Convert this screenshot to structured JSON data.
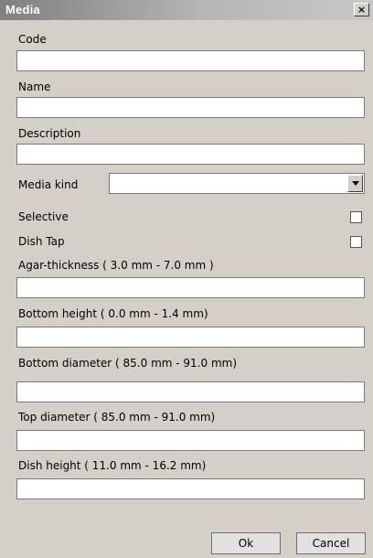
{
  "window": {
    "title": "Media",
    "close_label": "×"
  },
  "fields": {
    "code": {
      "label": "Code",
      "value": ""
    },
    "name": {
      "label": "Name",
      "value": ""
    },
    "description": {
      "label": "Description",
      "value": ""
    },
    "media_kind": {
      "label": "Media kind",
      "value": ""
    },
    "selective": {
      "label": "Selective",
      "checked": false
    },
    "dish_tap": {
      "label": "Dish Tap",
      "checked": false
    },
    "agar_thickness": {
      "label": "Agar-thickness ( 3.0 mm - 7.0 mm )",
      "value": ""
    },
    "bottom_height": {
      "label": "Bottom height ( 0.0 mm - 1.4 mm)",
      "value": ""
    },
    "bottom_diameter": {
      "label": "Bottom diameter ( 85.0 mm - 91.0 mm)",
      "value": ""
    },
    "top_diameter": {
      "label": "Top diameter ( 85.0 mm - 91.0 mm)",
      "value": ""
    },
    "dish_height": {
      "label": "Dish height ( 11.0 mm - 16.2 mm)",
      "value": ""
    }
  },
  "buttons": {
    "ok": "Ok",
    "cancel": "Cancel"
  }
}
